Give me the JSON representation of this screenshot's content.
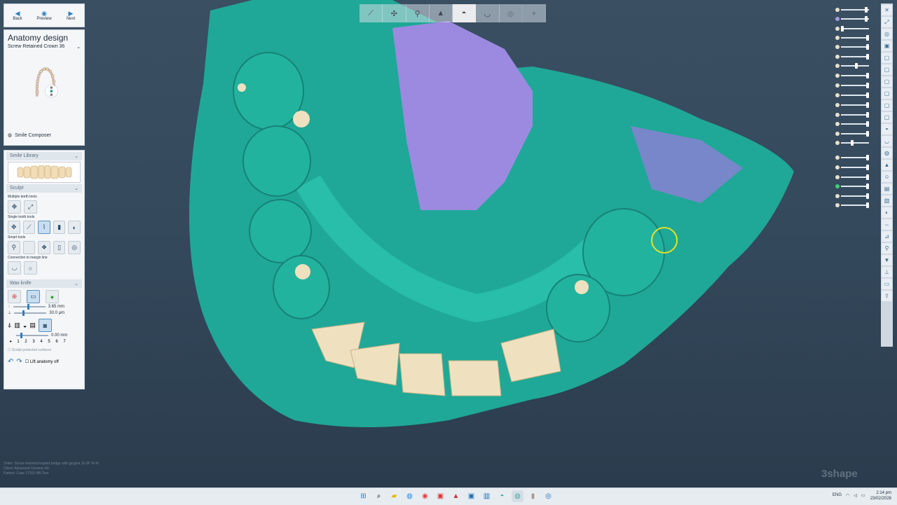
{
  "nav": {
    "back": "Back",
    "preview": "Preview",
    "next": "Next"
  },
  "anatomy": {
    "title": "Anatomy design",
    "item": "Screw Retained Crown 36",
    "smile_composer": "Smile Composer"
  },
  "tools": {
    "smile_library": "Smile Library",
    "sculpt": "Sculpt",
    "multiple": "Multiple teeth tools",
    "single": "Single tooth tools",
    "smart": "Smart tools",
    "margin": "Connection to margin line",
    "wax_knife": "Wax knife",
    "size1": "3.65 mm",
    "size2": "30.0 µm",
    "size3": "0.00 mm",
    "levels": [
      "1",
      "2",
      "3",
      "4",
      "5",
      "6",
      "7"
    ],
    "protected": "Sculpt protected surfaces",
    "lift": "Lift anatomy off"
  },
  "info": {
    "order_label": "Order:",
    "order": "Screw retained implant bridge with gingiva 16-26 Te-ht",
    "client_label": "Client:",
    "client": "Advanced Ceramic Kit",
    "patient_label": "Patient:",
    "patient": "Case 27115 NN Test"
  },
  "brand": "3shape",
  "tray": {
    "lang": "ENG",
    "time": "2:14 pm",
    "date": "23/02/2026"
  },
  "colors": {
    "model": "#1fa897",
    "tissue": "#9b8ae0",
    "tooth": "#efe1c0",
    "cursor": "#e6e224"
  }
}
